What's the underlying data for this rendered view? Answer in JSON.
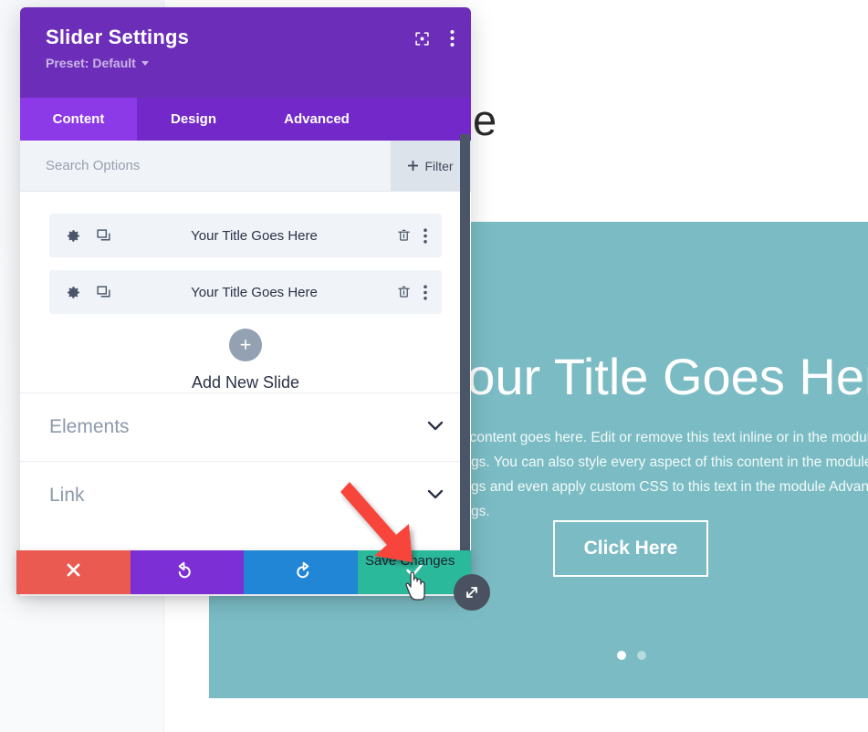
{
  "background": {
    "page_heading": "Home Page",
    "slider": {
      "title": "Your Title Goes Here",
      "body": "Your content goes here. Edit or remove this text inline or in the module Content settings. You can also style every aspect of this content in the module Design settings and even apply custom CSS to this text in the module Advanced settings.",
      "button_label": "Click Here",
      "dots": [
        {
          "label": "slide-1",
          "active": true
        },
        {
          "label": "slide-2",
          "active": false
        }
      ]
    },
    "resize_handle_icon": "resize-diagonal-icon"
  },
  "modal": {
    "title": "Slider Settings",
    "preset_label": "Preset: Default",
    "header_icons": [
      {
        "name": "focus-target-icon"
      },
      {
        "name": "more-vertical-icon"
      }
    ],
    "tabs": [
      {
        "label": "Content",
        "active": true
      },
      {
        "label": "Design",
        "active": false
      },
      {
        "label": "Advanced",
        "active": false
      }
    ],
    "search": {
      "placeholder": "Search Options",
      "value": ""
    },
    "filter_button": {
      "label": "Filter",
      "icon": "plus-icon"
    },
    "slides": [
      {
        "title": "Your Title Goes Here",
        "settings_icon": "gear-icon",
        "duplicate_icon": "duplicate-icon",
        "delete_icon": "trash-icon",
        "menu_icon": "more-vertical-icon"
      },
      {
        "title": "Your Title Goes Here",
        "settings_icon": "gear-icon",
        "duplicate_icon": "duplicate-icon",
        "delete_icon": "trash-icon",
        "menu_icon": "more-vertical-icon"
      }
    ],
    "add_slide": {
      "label": "Add New Slide",
      "icon": "plus-icon"
    },
    "sections": [
      {
        "label": "Elements",
        "expanded": false,
        "icon": "chevron-down-icon"
      },
      {
        "label": "Link",
        "expanded": false,
        "icon": "chevron-down-icon"
      }
    ]
  },
  "action_bar": {
    "buttons": [
      {
        "name": "discard",
        "icon": "close-x-icon",
        "color": "#eb5a50"
      },
      {
        "name": "undo",
        "icon": "undo-icon",
        "color": "#7d2fd6"
      },
      {
        "name": "redo",
        "icon": "redo-icon",
        "color": "#2186d6"
      },
      {
        "name": "save",
        "icon": "check-icon",
        "color": "#2bb99b"
      }
    ],
    "save_tooltip": "Save Changes"
  },
  "annotation": {
    "arrow_color": "#f8453b",
    "points_to": "save-changes-button"
  }
}
